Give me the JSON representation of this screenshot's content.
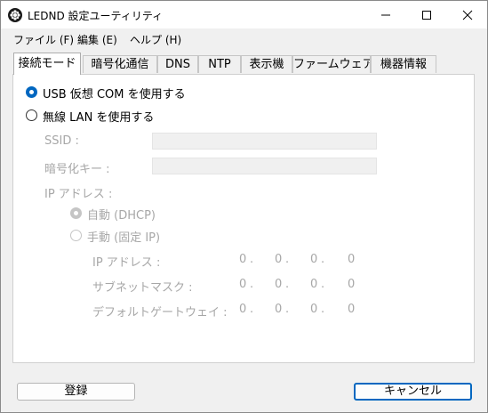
{
  "window": {
    "title": "LEDND 設定ユーティリティ"
  },
  "menu": [
    "ファイル (F)",
    "編集 (E)",
    "ヘルプ (H)"
  ],
  "tabs": [
    "接続モード",
    "暗号化通信",
    "DNS",
    "NTP",
    "表示機",
    "ファームウェア",
    "機器情報"
  ],
  "active_tab": "接続モード",
  "connection": {
    "usb_label": "USB 仮想 COM を使用する",
    "usb_selected": true,
    "wlan_label": "無線 LAN を使用する",
    "wlan_selected": false,
    "ssid_label": "SSID :",
    "ssid_value": "",
    "key_label": "暗号化キー :",
    "key_value": "",
    "ip_section_label": "IP アドレス :",
    "auto_label": "自動 (DHCP)",
    "auto_selected": true,
    "manual_label": "手動 (固定 IP)",
    "manual_selected": false,
    "fields": [
      {
        "label": "IP アドレス :",
        "octets": [
          "0",
          "0",
          "0",
          "0"
        ]
      },
      {
        "label": "サブネットマスク :",
        "octets": [
          "0",
          "0",
          "0",
          "0"
        ]
      },
      {
        "label": "デフォルトゲートウェイ :",
        "octets": [
          "0",
          "0",
          "0",
          "0"
        ]
      }
    ]
  },
  "buttons": {
    "register": "登録",
    "cancel": "キャンセル"
  },
  "colors": {
    "accent": "#0067c0",
    "disabled_text": "#a7a7a7"
  }
}
